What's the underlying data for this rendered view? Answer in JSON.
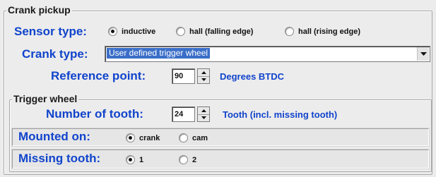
{
  "crank_pickup": {
    "title": "Crank pickup",
    "sensor_type": {
      "label": "Sensor type:",
      "options": [
        {
          "label": "inductive",
          "selected": true
        },
        {
          "label": "hall (falling edge)",
          "selected": false
        },
        {
          "label": "hall (rising edge)",
          "selected": false
        }
      ]
    },
    "crank_type": {
      "label": "Crank type:",
      "value": "User defined trigger wheel"
    },
    "reference_point": {
      "label": "Reference point:",
      "value": "90",
      "unit": "Degrees BTDC"
    }
  },
  "trigger_wheel": {
    "title": "Trigger wheel",
    "number_of_tooth": {
      "label": "Number of tooth:",
      "value": "24",
      "unit": "Tooth (incl. missing tooth)"
    },
    "mounted_on": {
      "label": "Mounted on:",
      "options": [
        {
          "label": "crank",
          "selected": true
        },
        {
          "label": "cam",
          "selected": false
        }
      ]
    },
    "missing_tooth": {
      "label": "Missing tooth:",
      "options": [
        {
          "label": "1",
          "selected": true
        },
        {
          "label": "2",
          "selected": false
        }
      ]
    }
  },
  "colors": {
    "label_blue": "#1144cc",
    "selection_blue": "#3a6ec8",
    "panel_bg": "#ececec"
  }
}
